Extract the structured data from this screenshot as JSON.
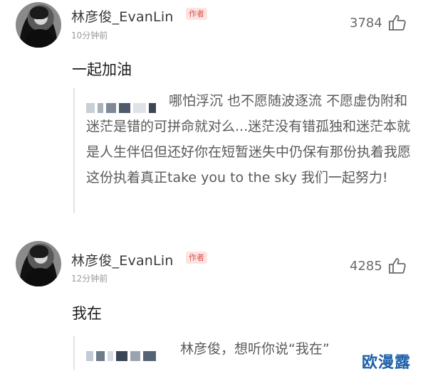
{
  "comments": [
    {
      "username": "林彦俊_EvanLin",
      "badge": "作者",
      "time": "10分钟前",
      "likes": "3784",
      "text": "一起加油",
      "quote": "哪怕浮沉 也不愿随波逐流 不愿虚伪附和 迷茫是错的可拼命就对么...迷茫没有错孤独和迷茫本就是人生伴侣但还好你在短暂迷失中仍保有那份执着我愿这份执着真正take you to the sky 我们一起努力!"
    },
    {
      "username": "林彦俊_EvanLin",
      "badge": "作者",
      "time": "12分钟前",
      "likes": "4285",
      "text": "我在",
      "quote": "林彦俊，想听你说“我在”"
    }
  ],
  "watermark": "欧漫露",
  "icons": {
    "like": "thumbs-up-icon"
  }
}
